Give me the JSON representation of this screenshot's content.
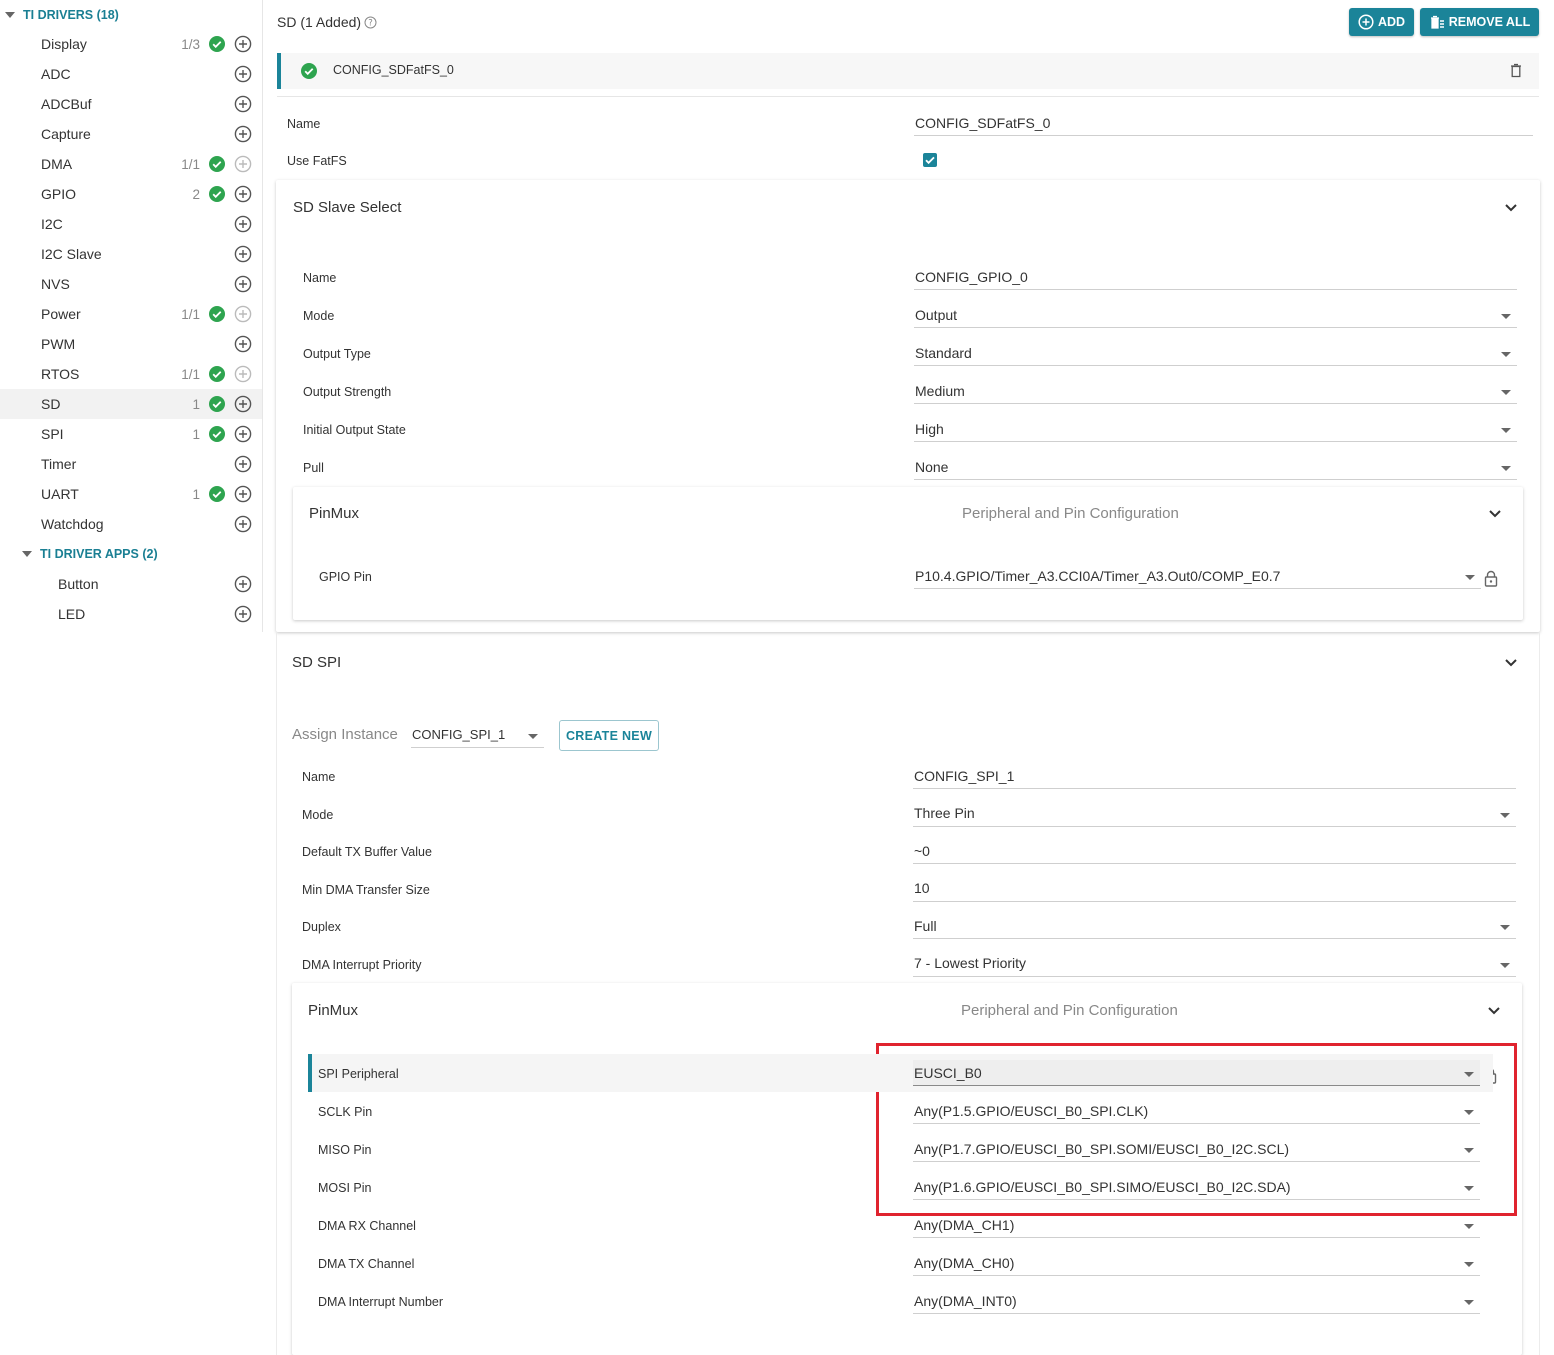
{
  "sidebar": {
    "drivers_header": "TI DRIVERS (18)",
    "items": [
      {
        "label": "Display",
        "count": "1/3",
        "checked": true,
        "plus_enabled": true
      },
      {
        "label": "ADC",
        "count": "",
        "checked": false,
        "plus_enabled": true
      },
      {
        "label": "ADCBuf",
        "count": "",
        "checked": false,
        "plus_enabled": true
      },
      {
        "label": "Capture",
        "count": "",
        "checked": false,
        "plus_enabled": true
      },
      {
        "label": "DMA",
        "count": "1/1",
        "checked": true,
        "plus_enabled": false
      },
      {
        "label": "GPIO",
        "count": "2",
        "checked": true,
        "plus_enabled": true
      },
      {
        "label": "I2C",
        "count": "",
        "checked": false,
        "plus_enabled": true
      },
      {
        "label": "I2C Slave",
        "count": "",
        "checked": false,
        "plus_enabled": true
      },
      {
        "label": "NVS",
        "count": "",
        "checked": false,
        "plus_enabled": true
      },
      {
        "label": "Power",
        "count": "1/1",
        "checked": true,
        "plus_enabled": false
      },
      {
        "label": "PWM",
        "count": "",
        "checked": false,
        "plus_enabled": true
      },
      {
        "label": "RTOS",
        "count": "1/1",
        "checked": true,
        "plus_enabled": false
      },
      {
        "label": "SD",
        "count": "1",
        "checked": true,
        "plus_enabled": true,
        "selected": true
      },
      {
        "label": "SPI",
        "count": "1",
        "checked": true,
        "plus_enabled": true
      },
      {
        "label": "Timer",
        "count": "",
        "checked": false,
        "plus_enabled": true
      },
      {
        "label": "UART",
        "count": "1",
        "checked": true,
        "plus_enabled": true
      },
      {
        "label": "Watchdog",
        "count": "",
        "checked": false,
        "plus_enabled": true
      }
    ],
    "apps_header": "TI DRIVER APPS (2)",
    "app_items": [
      {
        "label": "Button"
      },
      {
        "label": "LED"
      }
    ]
  },
  "header": {
    "title": "SD (1 Added)",
    "add_label": "ADD",
    "remove_all_label": "REMOVE ALL"
  },
  "instance": {
    "name": "CONFIG_SDFatFS_0"
  },
  "top_fields": {
    "name_label": "Name",
    "name_value": "CONFIG_SDFatFS_0",
    "use_fatfs_label": "Use FatFS",
    "use_fatfs_checked": true
  },
  "slave_select": {
    "title": "SD Slave Select",
    "fields": [
      {
        "label": "Name",
        "value": "CONFIG_GPIO_0",
        "dropdown": false
      },
      {
        "label": "Mode",
        "value": "Output",
        "dropdown": true
      },
      {
        "label": "Output Type",
        "value": "Standard",
        "dropdown": true
      },
      {
        "label": "Output Strength",
        "value": "Medium",
        "dropdown": true
      },
      {
        "label": "Initial Output State",
        "value": "High",
        "dropdown": true
      },
      {
        "label": "Pull",
        "value": "None",
        "dropdown": true
      }
    ],
    "pinmux": {
      "title": "PinMux",
      "subtitle": "Peripheral and Pin Configuration",
      "gpio_pin_label": "GPIO Pin",
      "gpio_pin_value": "P10.4.GPIO/Timer_A3.CCI0A/Timer_A3.Out0/COMP_E0.7"
    }
  },
  "sd_spi": {
    "title": "SD SPI",
    "assign_label": "Assign Instance",
    "assign_value": "CONFIG_SPI_1",
    "create_new_label": "CREATE NEW",
    "fields": [
      {
        "label": "Name",
        "value": "CONFIG_SPI_1",
        "dropdown": false
      },
      {
        "label": "Mode",
        "value": "Three Pin",
        "dropdown": true
      },
      {
        "label": "Default TX Buffer Value",
        "value": "~0",
        "dropdown": false
      },
      {
        "label": "Min DMA Transfer Size",
        "value": "10",
        "dropdown": false
      },
      {
        "label": "Duplex",
        "value": "Full",
        "dropdown": true
      },
      {
        "label": "DMA Interrupt Priority",
        "value": "7 - Lowest Priority",
        "dropdown": true
      }
    ],
    "pinmux": {
      "title": "PinMux",
      "subtitle": "Peripheral and Pin Configuration",
      "fields": [
        {
          "label": "SPI Peripheral",
          "value": "EUSCI_B0"
        },
        {
          "label": "SCLK Pin",
          "value": "Any(P1.5.GPIO/EUSCI_B0_SPI.CLK)"
        },
        {
          "label": "MISO Pin",
          "value": "Any(P1.7.GPIO/EUSCI_B0_SPI.SOMI/EUSCI_B0_I2C.SCL)"
        },
        {
          "label": "MOSI Pin",
          "value": "Any(P1.6.GPIO/EUSCI_B0_SPI.SIMO/EUSCI_B0_I2C.SDA)"
        },
        {
          "label": "DMA RX Channel",
          "value": "Any(DMA_CH1)"
        },
        {
          "label": "DMA TX Channel",
          "value": "Any(DMA_CH0)"
        },
        {
          "label": "DMA Interrupt Number",
          "value": "Any(DMA_INT0)"
        }
      ]
    }
  },
  "colors": {
    "accent": "#1b8499",
    "check_green": "#2ea44f",
    "highlight_red": "#e0232e"
  }
}
